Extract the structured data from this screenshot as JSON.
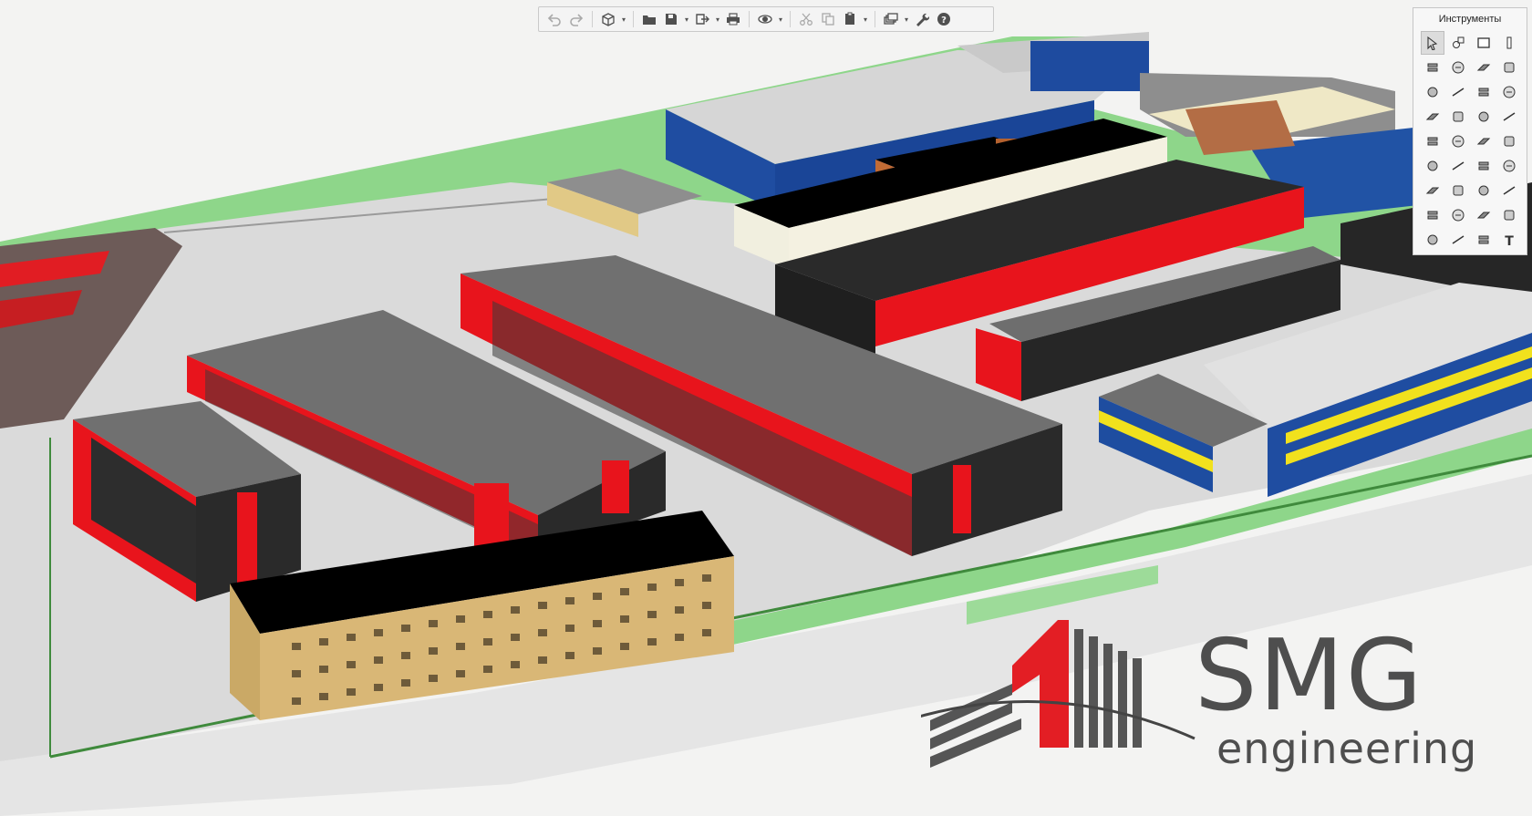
{
  "app": {
    "viewport_label": "3D model viewport"
  },
  "toolbar": {
    "buttons": [
      {
        "icon": "undo-icon",
        "enabled": false
      },
      {
        "icon": "redo-icon",
        "enabled": false
      },
      {
        "icon": "view-cube-icon",
        "has_menu": true
      },
      {
        "icon": "open-folder-icon"
      },
      {
        "icon": "save-icon",
        "has_menu": true
      },
      {
        "icon": "export-icon",
        "has_menu": true
      },
      {
        "icon": "print-icon"
      },
      {
        "icon": "orbit-icon",
        "has_menu": true
      },
      {
        "icon": "cut-icon",
        "enabled": false
      },
      {
        "icon": "copy-icon",
        "enabled": false
      },
      {
        "icon": "paste-icon",
        "has_menu": true
      },
      {
        "icon": "layers-icon",
        "has_menu": true
      },
      {
        "icon": "wrench-icon"
      },
      {
        "icon": "help-icon"
      }
    ]
  },
  "tools_panel": {
    "title": "Инструменты",
    "tools": [
      "arrow-select-icon",
      "node-edit-icon",
      "rectangle-icon",
      "column-icon",
      "slab-icon",
      "beam-icon",
      "roof-icon",
      "pencil-icon",
      "stair-icon",
      "railing-icon",
      "door-icon",
      "window-icon",
      "truss-icon",
      "line-icon",
      "figure-icon",
      "pipe-icon",
      "equipment-icon",
      "boiler-icon",
      "valve-icon",
      "duct-icon",
      "pump-icon",
      "fitting-icon",
      "fan-icon",
      "elbow-icon",
      "gear-pump-icon",
      "shape-icon",
      "rotate-icon",
      "box-icon",
      "panel-icon",
      "sphere-icon",
      "section-icon",
      "cabinet-icon",
      "dimension-icon",
      "angle-icon",
      "tag-icon",
      "text-icon"
    ]
  },
  "logo": {
    "name": "SMG",
    "subtitle": "engineering",
    "colors": {
      "mark_red": "#e31e24",
      "text_gray": "#4e4e4e"
    }
  },
  "colors": {
    "background": "#f2f2f0",
    "grass": "#8ed68a",
    "ground": "#d8d8d8",
    "roof_gray": "#6e6e6e",
    "wall_dark": "#2b2b2b",
    "accent_red": "#e8141c",
    "blue_building": "#1d4ca0",
    "yellow_stripe": "#f1e11d",
    "beige_building": "#d9b776",
    "brown_building": "#c16b35"
  }
}
